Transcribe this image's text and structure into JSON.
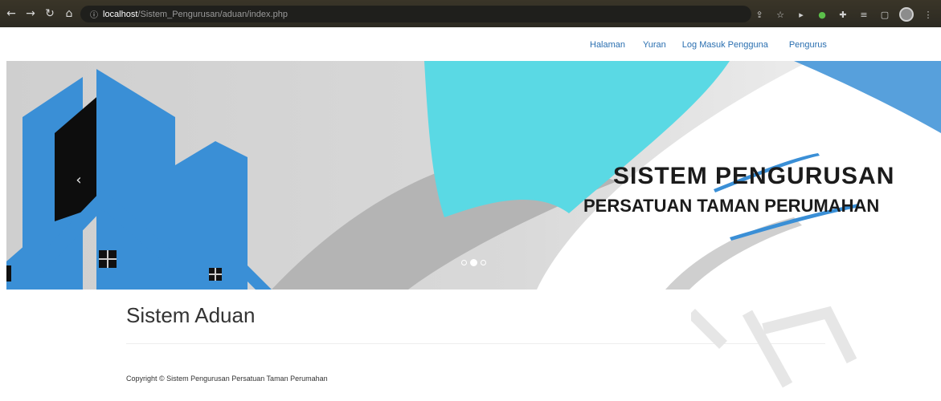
{
  "browser": {
    "url_host": "localhost",
    "url_path": "/Sistem_Pengurusan/aduan/index.php",
    "icons": [
      "back-icon",
      "forward-icon",
      "reload-icon",
      "home-icon",
      "info-icon",
      "share-icon",
      "star-icon",
      "extension-icons",
      "menu-icon"
    ]
  },
  "navbar": {
    "links": [
      "Halaman",
      "Yuran",
      "Log Masuk Pengguna",
      "Pengurus"
    ]
  },
  "carousel": {
    "caption_line1": "SISTEM PENGURUSAN",
    "caption_line2": "PERSATUAN TAMAN PERUMAHAN",
    "prev_glyph": "‹",
    "slide_count": 3,
    "active_slide": 2,
    "colors": {
      "blue": "#3a8fd6",
      "cyan": "#5ad9e4",
      "grey": "#bcbcbc"
    }
  },
  "main": {
    "title": "Sistem Aduan"
  },
  "footer": {
    "copyright": "Copyright © Sistem Pengurusan Persatuan Taman Perumahan"
  }
}
